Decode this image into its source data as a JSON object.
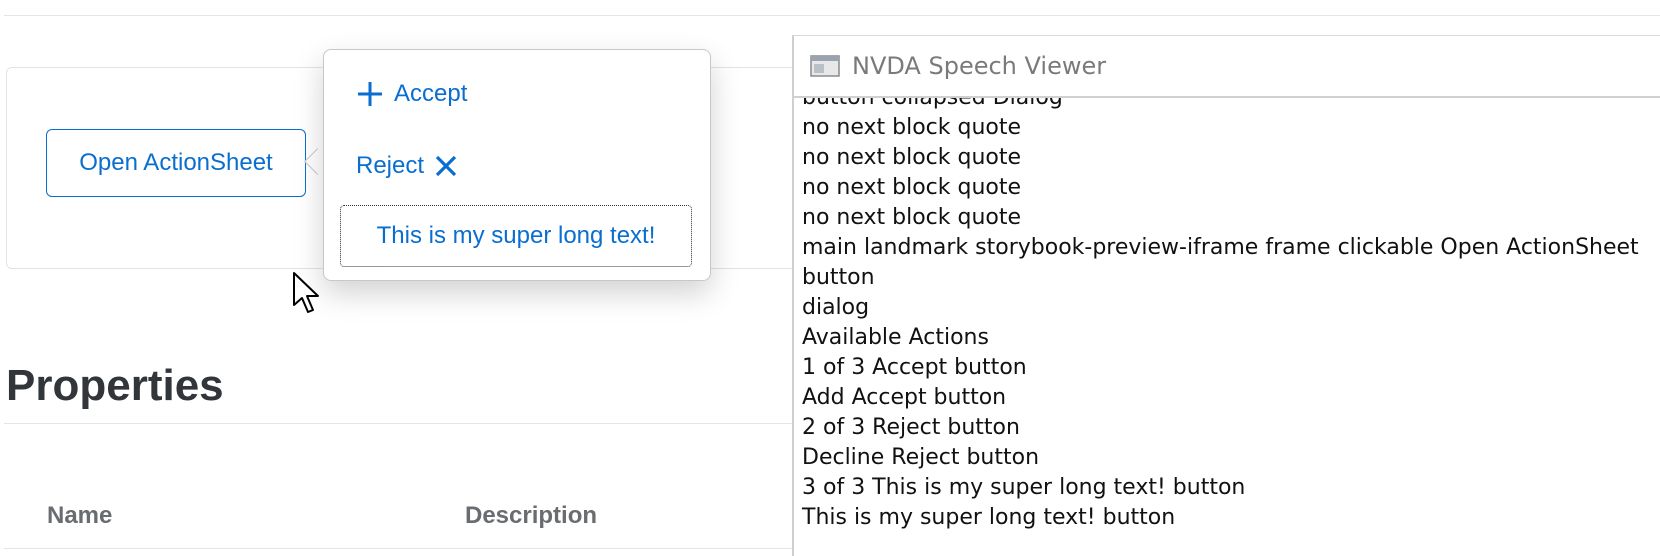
{
  "canvas": {
    "open_button_label": "Open ActionSheet"
  },
  "action_sheet": {
    "actions": [
      {
        "label": "Accept",
        "icon": "plus-icon"
      },
      {
        "label": "Reject",
        "icon": "close-icon"
      },
      {
        "label": "This is my super long text!"
      }
    ]
  },
  "docs": {
    "properties_title": "Properties",
    "columns": [
      "Name",
      "Description"
    ]
  },
  "speech_viewer": {
    "title": "NVDA Speech Viewer",
    "lines": [
      "button  collapsed   Dialog",
      "no next block quote",
      "no next block quote",
      "no next block quote",
      "no next block quote",
      "main landmark    storybook-preview-iframe  frame    clickable  Open ActionSheet",
      "button",
      "dialog",
      "Available Actions",
      "1 of 3 Accept  button",
      "Add Accept  button",
      "2 of 3 Reject  button",
      "Decline Reject  button",
      "3 of 3 This is my super long text!  button",
      "This is my super long text!  button"
    ]
  },
  "colors": {
    "accent": "#0a6ed1",
    "text_dark": "#32363a",
    "header_gray": "#6a6d70"
  }
}
